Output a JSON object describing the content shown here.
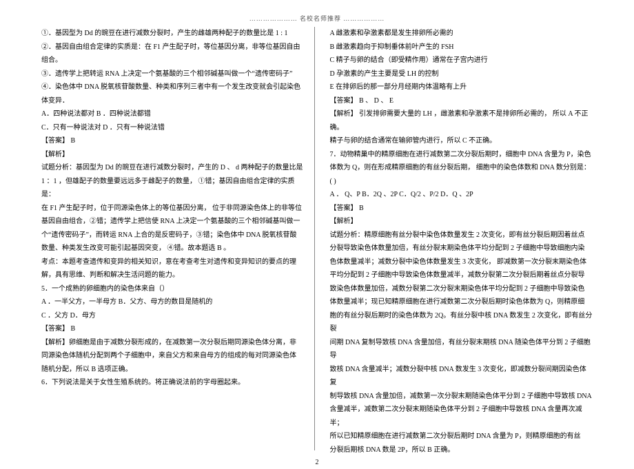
{
  "header": "………………… 名校名师推荐 ………………",
  "page_number": "2",
  "left": {
    "l1": "①．基因型为 Dd 的豌豆在进行减数分裂时，产生的雌雄两种配子的数量比是        1 : 1",
    "l2": "②．基因自由组合定律的实质是：在      F1 产生配子时，等位基因分离，非等位基因自由",
    "l3": "组合。",
    "l4": "③．遗传学上把转运     RNA 上决定一个氨基酸的三个相邻碱基叫做一个“遗传密码子”",
    "l5": "④．染色体中 DNA 脱氧核苷酸数量、种类和序列三者中有一个发生改变就会引起染色",
    "l6": "体变异．",
    "l7": "A．四种说法都对        B ．四种说法都错",
    "l8": "C．只有一种说法对      D  ．只有一种说法错",
    "l9": "【答案】 B",
    "l10": "【解析】",
    "l11": "试题分析：基因型为    Dd 的豌豆在进行减数分裂时，产生的      D 、 d 两种配子的数量比是",
    "l12": "1 ：1 ，但雄配子的数量要远远多于雌配子的数量，    ①错；基因自由组合定律的实质是：",
    "l13": "在 F1 产生配子时，位于同源染色体上的等位基因分离，      位于非同源染色体上的非等位",
    "l14": "基因自由组合，②错；遗传学上把信使     RNA 上决定一个氨基酸的三个相邻碱基叫做一",
    "l15": "个“遗传密码子”，而转运 RNA 上合的是反密码子，③错；染色体中     DNA 脱氧核苷酸",
    "l16": "数量、种类发生改变可能引起基因突变，    ④错。故本题选    B 。",
    "l17": "考点：本题考查遗传和变异的相关知识，意在考查考生对遗传和变异知识的要点的理",
    "l18": "解，具有思维、判断和解决生活问题的能力。",
    "l19": "5．一个成熟的卵细胞内的染色体来自（）",
    "l20": "A ．一半父方，一半母方     B．父方、母方的数目是随机的",
    "l21": "C ．父方 D．母方",
    "l22": "【答案】 B",
    "l23": "【解析】卵细胞是由于减数分裂形成的，在减数第一次分裂后期同源染色体分离，非",
    "l24": "同源染色体随机分配到两个子细胞中，来自父方和来自母方的组成的每对同源染色体",
    "l25": "随机分配，所以   B 选项正确。",
    "l26": "6．下列说法是关于女性生殖系统的。将正确说法前的字母圈起来。"
  },
  "right": {
    "l1": "A 雌激素和孕激素都是发生排卵所必需的",
    "l2": "B 雌激素趋向于抑制垂体前叶产生的    FSH",
    "l3": "C 精子与卵的结合（即受精作用）通常在子宫内进行",
    "l4": "D 孕激素的产生主要是受     LH 的控制",
    "l5": "E 在排卵后的那一部分月经期内体温略有上升",
    "l6": "【答案】 B 、 D 、 E",
    "l7": "【解析】 引发排卵需要大量的    LH ，雌激素和孕激素不是排卵所必需的，     所以 A 不正确。",
    "l8": "精子与卵的结合通常在输卵管内进行，所以     C 不正确。",
    "l9": "7．动物精巢中的精原细胞在进行减数第二次分裂后期时，细胞中        DNA 含量为 P，染色",
    "l10": "体数为 Q，则在形成精原细胞的有丝分裂后期，    细胞中的染色体数和     DNA 数分别是：( )",
    "l11": "A ． Q、P B．2Q 、2P C．Q/2 、P/2 D．Q 、2P",
    "l12": "【答案】 B",
    "l13": "【解析】",
    "l14": "试题分析：精原细胞有丝分裂中染色体数量发生      2 次变化，即有丝分裂后期因着丝点",
    "l15": "分裂导致染色体数量加倍，有丝分裂末期染色体平均分配到        2 子细胞中导致细胞内染",
    "l16": "色体数量减半；减数分裂中染色体数量发生       3 次变化，   即减数第一次分裂末期染色体",
    "l17": "平均分配到  2 子细胞中导致染色体数量减半，减数分裂第二次分裂后期着丝点分裂导",
    "l18": "致染色体数量加倍，减数分裂第二次分裂末期染色体平均分配到         2 子细胞中导致染色",
    "l19": "体数量减半；现已知精原细胞在进行减数第二次分裂后期时染色体数为         Q，则精原细",
    "l20": "胞的有丝分裂后期时的染色体数为     2Q。有丝分裂中核 DNA 数发生 2 次变化，即有丝分裂",
    "l21": "间期 DNA 复制导致核 DNA 含量加倍，有丝分裂末期核   DNA 随染色体平分到  2 子细胞导",
    "l22": "致核 DNA 含量减半；减数分裂中核   DNA 数发生 3 次变化，即减数分裂间期因染色体复",
    "l23": "制导致核 DNA 含量加倍，减数第一次分裂末期随染色体平分到       2 子细胞中导致核 DNA",
    "l24": "含量减半，减数第二次分裂末期随染色体平分到       2 子细胞中导致核  DNA 含量再次减半；",
    "l25": "所以已知精原细胞在进行减数第二次分裂后期时        DNA 含量为 P，则精原细胞的有丝",
    "l26": "分裂后期核 DNA 数是 2P，所以 B 正确。"
  }
}
